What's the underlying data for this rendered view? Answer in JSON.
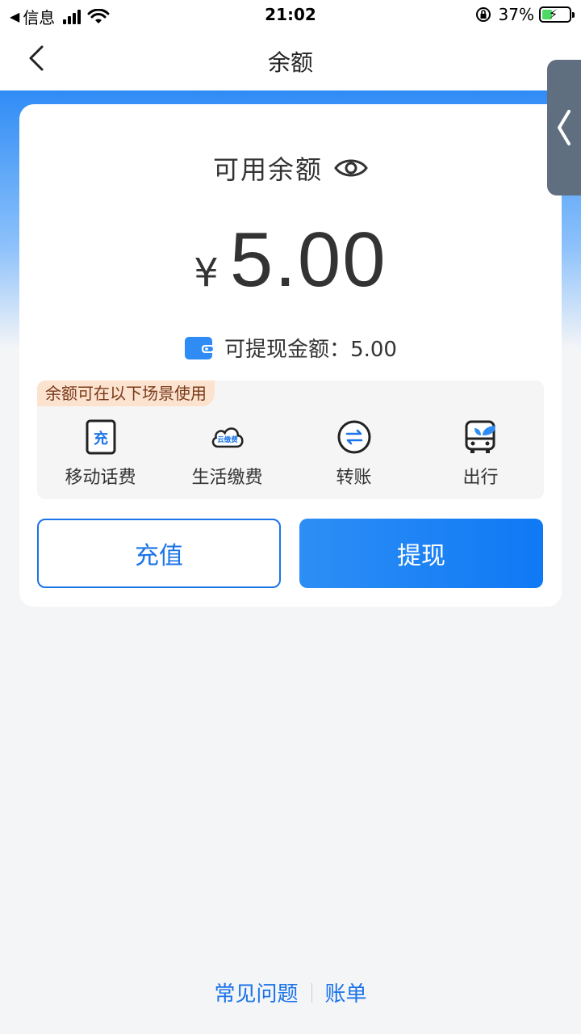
{
  "status_bar": {
    "back_app": "信息",
    "time": "21:02",
    "battery_percent": "37%"
  },
  "nav": {
    "title": "余额"
  },
  "balance": {
    "available_label": "可用余额",
    "currency_symbol": "¥",
    "amount": "5.00",
    "withdrawable_label": "可提现金额：",
    "withdrawable_amount": "5.00"
  },
  "scenes": {
    "tag": "余额可在以下场景使用",
    "items": [
      {
        "label": "移动话费",
        "icon": "mobile-recharge-icon",
        "badge": "充"
      },
      {
        "label": "生活缴费",
        "icon": "cloud-payment-icon",
        "badge": "云缴费"
      },
      {
        "label": "转账",
        "icon": "transfer-icon"
      },
      {
        "label": "出行",
        "icon": "bus-icon"
      }
    ]
  },
  "actions": {
    "recharge": "充值",
    "withdraw": "提现"
  },
  "footer": {
    "faq": "常见问题",
    "bill": "账单"
  },
  "colors": {
    "accent": "#1a73e8",
    "band_top": "#2f8cf5",
    "tag_bg": "#fbe3cf"
  }
}
